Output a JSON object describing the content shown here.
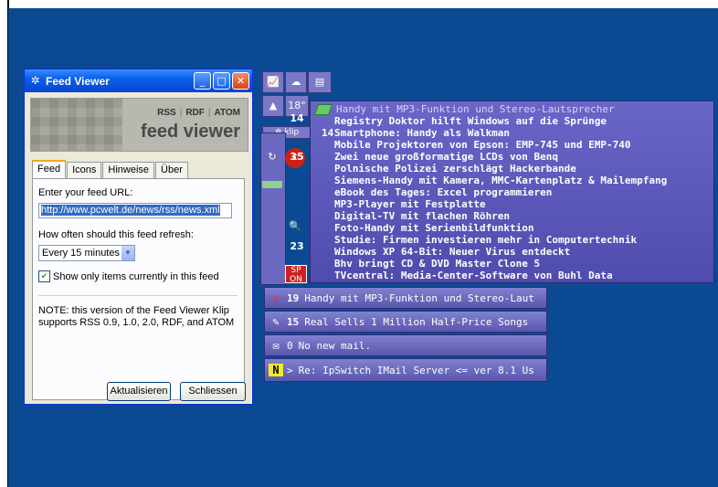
{
  "window": {
    "title": "Feed Viewer",
    "buttons": {
      "minimize": "_",
      "maximize": "□",
      "close": "✕"
    }
  },
  "banner": {
    "formats": [
      "RSS",
      "RDF",
      "ATOM"
    ],
    "logo": "feed viewer"
  },
  "tabs": [
    {
      "label": "Feed",
      "active": true
    },
    {
      "label": "Icons",
      "active": false
    },
    {
      "label": "Hinweise",
      "active": false
    },
    {
      "label": "Über",
      "active": false
    }
  ],
  "form": {
    "url_label": "Enter your feed URL:",
    "url_value": "http://www.pcwelt.de/news/rss/news.xml",
    "refresh_label": "How often should this feed refresh:",
    "refresh_value": "Every 15 minutes",
    "checkbox_label": "Show only items currently in this feed",
    "checkbox_checked": true,
    "note": "NOTE: this version of the Feed Viewer Klip supports RSS 0.9, 1.0, 2.0, RDF, and ATOM"
  },
  "buttons": {
    "refresh": "Aktualisieren",
    "close": "Schliessen"
  },
  "klips": {
    "weather_temp": "18°",
    "side_counts": [
      "14",
      "35",
      "23"
    ],
    "rows": [
      {
        "icon": "heise-icon",
        "count": "19",
        "text": "Handy mit MP3-Funktion und Stereo-Laut"
      },
      {
        "icon": "tag-icon",
        "count": "15",
        "text": "Real Sells 1 Million Half-Price Songs"
      },
      {
        "icon": "mail-icon",
        "count": "0",
        "text": "No new mail."
      },
      {
        "icon": "news-icon",
        "count": ">",
        "text": "Re: IpSwitch IMail Server <= ver 8.1 Us"
      }
    ]
  },
  "popup": {
    "header": "Handy mit MP3-Funktion und Stereo-Lautsprecher",
    "count": "14",
    "items": [
      "Registry Doktor hilft Windows auf die Sprünge",
      "Smartphone: Handy als Walkman",
      "Mobile Projektoren von Epson: EMP-745 und EMP-740",
      "Zwei neue großformatige LCDs von Benq",
      "Polnische Polizei zerschlägt Hackerbande",
      "Siemens-Handy mit Kamera, MMC-Kartenplatz & Mailempfang",
      "eBook des Tages: Excel programmieren",
      "MP3-Player mit Festplatte",
      "Digital-TV mit flachen Röhren",
      "Foto-Handy mit Serienbildfunktion",
      "Studie: Firmen investieren mehr in Computertechnik",
      "Windows XP 64-Bit: Neuer Virus entdeckt",
      "Bhv bringt CD & DVD Master Clone 5",
      "TVcentral: Media-Center-Software von Buhl Data"
    ]
  },
  "colors": {
    "desktop": "#0b4a93",
    "klip": "#6a66c8"
  }
}
